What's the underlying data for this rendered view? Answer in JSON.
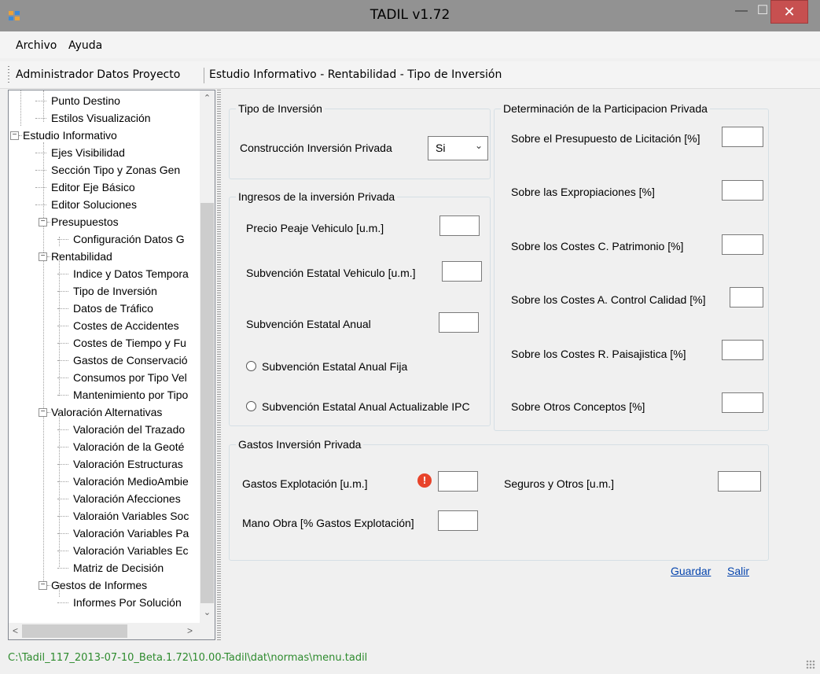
{
  "window": {
    "title": "TADIL v1.72"
  },
  "menu": [
    "Archivo",
    "Ayuda"
  ],
  "toolbar": {
    "admin": "Administrador Datos Proyecto",
    "breadcrumb": "Estudio Informativo - Rentabilidad - Tipo de Inversión"
  },
  "tree": [
    "Punto Destino",
    "Estilos Visualización",
    "Estudio Informativo",
    "Ejes Visibilidad",
    "Sección Tipo y Zonas Gen",
    "Editor Eje Básico",
    "Editor Soluciones",
    "Presupuestos",
    "Configuración Datos G",
    "Rentabilidad",
    "Indice y Datos Tempora",
    "Tipo de Inversión",
    "Datos de Tráfico",
    "Costes de Accidentes",
    "Costes de Tiempo y Fu",
    "Gastos de Conservació",
    "Consumos por Tipo Vel",
    "Mantenimiento por Tipo",
    "Valoración Alternativas",
    "Valoración del Trazado",
    "Valoración de la Geoté",
    "Valoración Estructuras",
    "Valoración MedioAmbie",
    "Valoración Afecciones",
    "Valoraión Variables Soc",
    "Valoración Variables Pa",
    "Valoración Variables Ec",
    "Matriz de Decisión",
    "Gestos de Informes",
    "Informes Por Solución"
  ],
  "tipo_inversion": {
    "legend": "Tipo de Inversión",
    "label": "Construcción Inversión Privada",
    "value": "Si"
  },
  "ingresos": {
    "legend": "Ingresos de la inversión Privada",
    "precio": "Precio Peaje Vehiculo [u.m.]",
    "subv_vehiculo": "Subvención Estatal Vehiculo [u.m.]",
    "subv_anual": "Subvención Estatal Anual",
    "radio_fija": "Subvención Estatal Anual Fija",
    "radio_ipc": "Subvención Estatal Anual Actualizable IPC"
  },
  "participacion": {
    "legend": "Determinación de la Participacion Privada",
    "items": [
      "Sobre el Presupuesto de Licitación [%]",
      "Sobre las Expropiaciones [%]",
      "Sobre los Costes C. Patrimonio [%]",
      "Sobre los Costes A. Control Calidad [%]",
      "Sobre los Costes R. Paisajistica [%]",
      "Sobre Otros Conceptos [%]"
    ]
  },
  "gastos": {
    "legend": "Gastos Inversión Privada",
    "explotacion": "Gastos Explotación  [u.m.]",
    "seguros": "Seguros y Otros  [u.m.]",
    "mano_obra": "Mano Obra [% Gastos Explotación]"
  },
  "actions": {
    "guardar": "Guardar",
    "salir": "Salir"
  },
  "status": {
    "path": "C:\\Tadil_117_2013-07-10_Beta.1.72\\10.00-Tadil\\dat\\normas\\menu.tadil"
  },
  "colors": {
    "titlebar": "#929292",
    "close": "#c75050",
    "link": "#0645ad",
    "status_text": "#2e8b2e",
    "error": "#e8432a"
  }
}
